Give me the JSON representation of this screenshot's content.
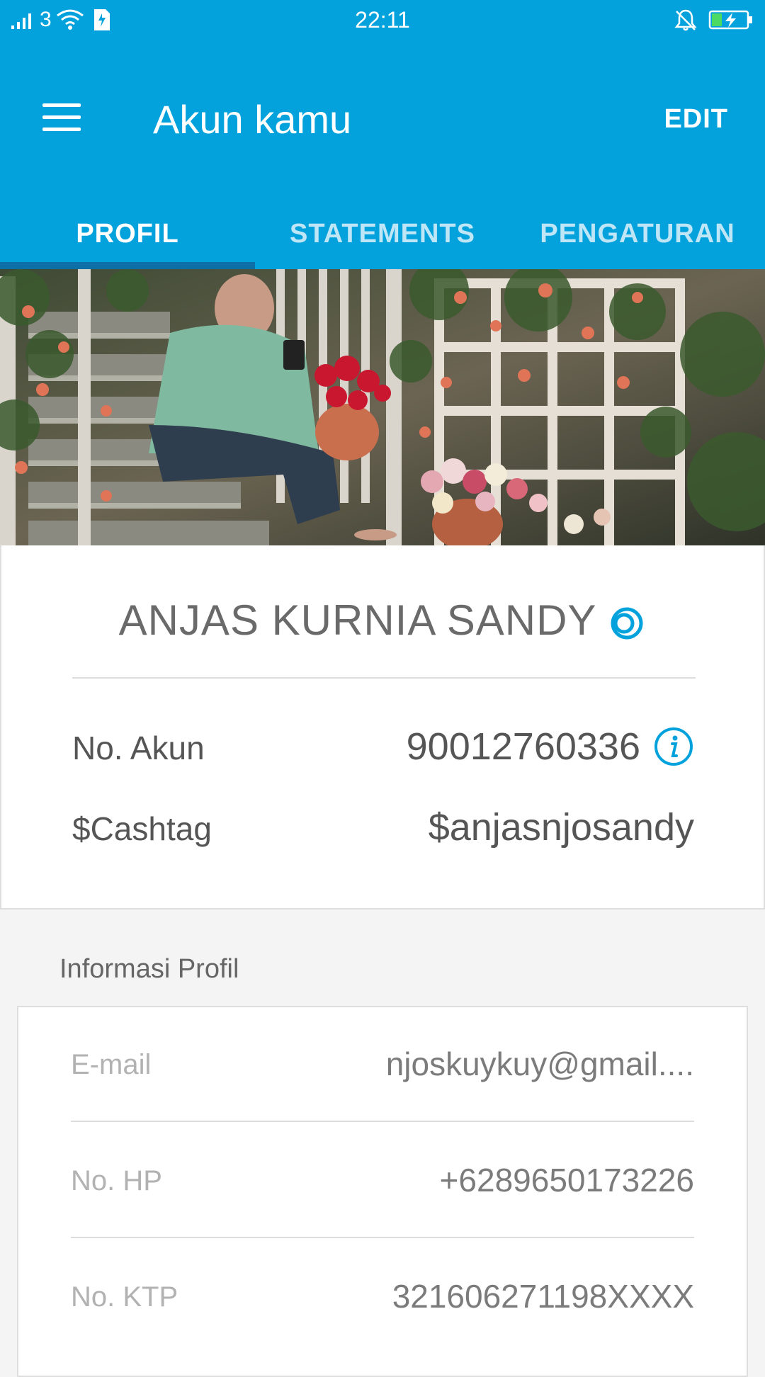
{
  "status_bar": {
    "carrier_label": "3",
    "time": "22:11"
  },
  "app_bar": {
    "title": "Akun kamu",
    "edit_label": "EDIT",
    "menu_icon": "hamburger-menu-icon"
  },
  "tabs": [
    {
      "label": "PROFIL",
      "active": true
    },
    {
      "label": "STATEMENTS",
      "active": false
    },
    {
      "label": "PENGATURAN",
      "active": false
    }
  ],
  "profile": {
    "name": "ANJAS KURNIA SANDY",
    "verified_icon": "verified-badge-icon",
    "rows": [
      {
        "label": "No. Akun",
        "value": "90012760336",
        "icon": "info-icon"
      },
      {
        "label": "$Cashtag",
        "value": "$anjasnjosandy"
      }
    ]
  },
  "profile_info": {
    "section_title": "Informasi Profil",
    "rows": [
      {
        "label": "E-mail",
        "value": "njoskuykuy@gmail...."
      },
      {
        "label": "No. HP",
        "value": "+6289650173226"
      },
      {
        "label": "No. KTP",
        "value": "321606271198XXXX"
      }
    ]
  },
  "colors": {
    "primary": "#03a2dc",
    "tab_indicator": "#0c6fa6",
    "background": "#f4f4f4"
  }
}
